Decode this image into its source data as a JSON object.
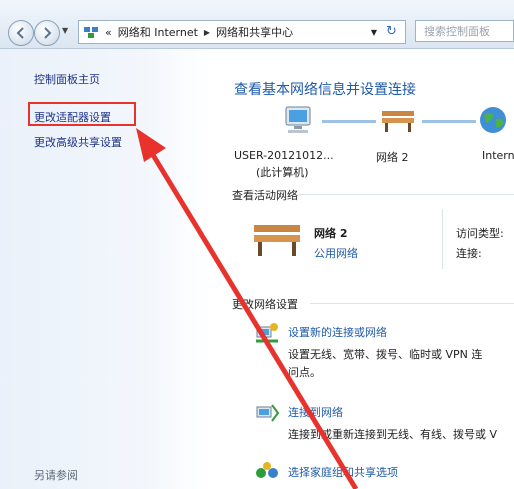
{
  "address": {
    "segments": [
      "«",
      "网络和 Internet",
      "网络和共享中心"
    ],
    "search_placeholder": "搜索控制面板"
  },
  "sidebar": {
    "home": "控制面板主页",
    "items": [
      "更改适配器设置",
      "更改高级共享设置"
    ],
    "see_also": "另请参阅"
  },
  "main": {
    "title": "查看基本网络信息并设置连接",
    "map": {
      "computer": "USER-20121012...",
      "computer_sub": "(此计算机)",
      "network": "网络  2",
      "internet": "Intern"
    },
    "active_section": "查看活动网络",
    "active_network": {
      "name": "网络  2",
      "type": "公用网络",
      "access_type_label": "访问类型:",
      "connections_label": "连接:"
    },
    "change_section": "更改网络设置",
    "tasks": [
      {
        "title": "设置新的连接或网络",
        "desc1": "设置无线、宽带、拨号、临时或 VPN 连",
        "desc2": "问点。"
      },
      {
        "title": "连接到网络",
        "desc1": "连接到或重新连接到无线、有线、拨号或 V",
        "desc2": ""
      },
      {
        "title": "选择家庭组和共享选项",
        "desc1": "",
        "desc2": ""
      }
    ]
  },
  "colors": {
    "link": "#1e5aa8",
    "annotation_arrow": "#e8332d",
    "highlight_box": "#e8332d"
  }
}
